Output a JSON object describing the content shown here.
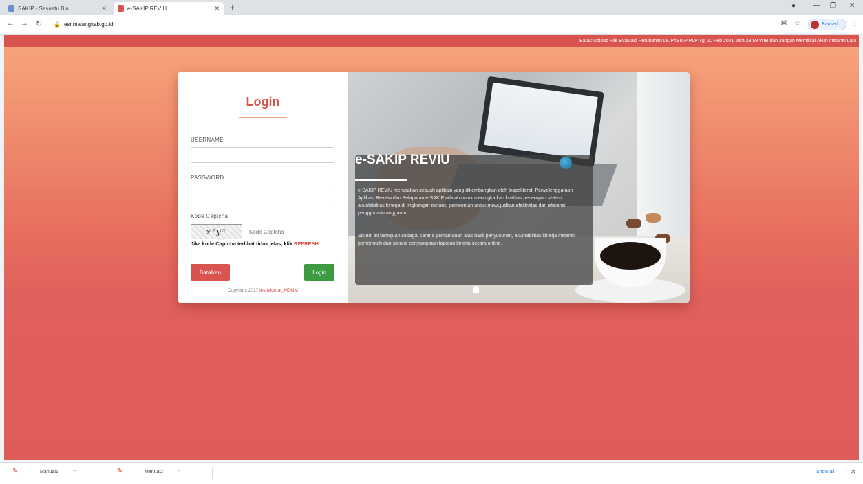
{
  "browser": {
    "tabs": [
      {
        "title": "SAKIP - Sesuatu Biru",
        "active": false
      },
      {
        "title": "e-SAKIP REVIU",
        "active": true
      }
    ],
    "url": "esr.malangkab.go.id",
    "profile_label": "Paused"
  },
  "page": {
    "marquee": "Batas Upload File Evaluasi Perubahan LKIP/ISIAP PLP Tgl 20 Feb 2021 Jam 23.59 WIB dan Jangan Memakai Akun Instansi Lain",
    "login": {
      "title": "Login",
      "username_label": "USERNAME",
      "username_value": "",
      "password_label": "PASSWORD",
      "password_value": "",
      "captcha_label": "Kode Captcha",
      "captcha_text": "x²y³",
      "captcha_placeholder": "Kode Captcha",
      "captcha_note": "Jika kode Captcha terlihat tidak jelas, klik ",
      "captcha_refresh": "REFRESH",
      "reset_button": "Batalkan",
      "login_button": "Login",
      "copyright_prefix": "Copyright 2017 ",
      "copyright_brand": "Inspektorat_MDNM"
    },
    "hero": {
      "title": "e-SAKIP REVIU",
      "paragraph1": "e-SAKIP REVIU merupakan sebuah aplikasi yang dikembangkan oleh Inspektorat. Penyelenggaraan Aplikasi Review dan Pelaporan e-SAKIP adalah untuk meningkatkan kualitas penerapan sistem akuntabilitas kinerja di lingkungan instansi pemerintah untuk mewujudkan efektivitas dan efisiensi penggunaan anggaran.",
      "paragraph2": "Sistem ini bertujuan sebagai sarana pemantauan atas hasil penyusunan, akuntabilitas kinerja instansi pemerintah dan sarana penyampaian laporan kinerja secara online."
    }
  },
  "downloads": {
    "items": [
      {
        "name": "Manual1"
      },
      {
        "name": "Manual2"
      }
    ],
    "show_all": "Show all"
  }
}
